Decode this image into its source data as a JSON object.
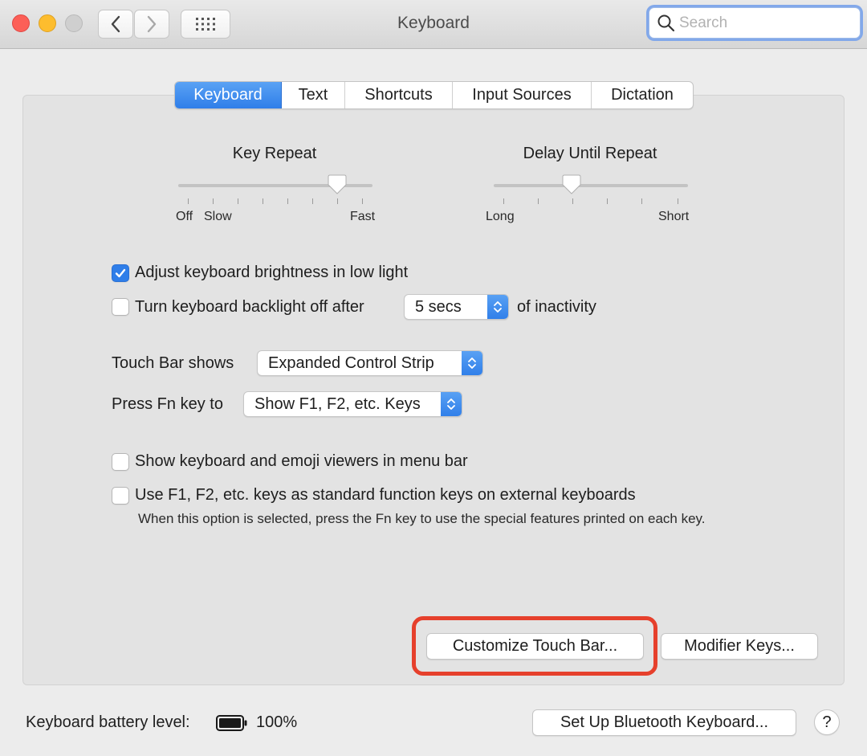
{
  "window": {
    "title": "Keyboard"
  },
  "search": {
    "placeholder": "Search"
  },
  "tabs": [
    {
      "label": "Keyboard",
      "active": true
    },
    {
      "label": "Text"
    },
    {
      "label": "Shortcuts"
    },
    {
      "label": "Input Sources"
    },
    {
      "label": "Dictation"
    }
  ],
  "key_repeat": {
    "title": "Key Repeat",
    "labels": {
      "off": "Off",
      "slow": "Slow",
      "fast": "Fast"
    },
    "value_fraction": 0.82
  },
  "delay_until_repeat": {
    "title": "Delay Until Repeat",
    "labels": {
      "long": "Long",
      "short": "Short"
    },
    "value_fraction": 0.4
  },
  "options": {
    "brightness": {
      "label": "Adjust keyboard brightness in low light",
      "checked": true
    },
    "backlight": {
      "label": "Turn keyboard backlight off after",
      "checked": false,
      "selected": "5 secs",
      "suffix": "of inactivity"
    }
  },
  "touch_bar": {
    "label": "Touch Bar shows",
    "selected": "Expanded Control Strip"
  },
  "fn_key": {
    "label": "Press Fn key to",
    "selected": "Show F1, F2, etc. Keys"
  },
  "viewers": {
    "label": "Show keyboard and emoji viewers in menu bar",
    "checked": false
  },
  "function_keys": {
    "label": "Use F1, F2, etc. keys as standard function keys on external keyboards",
    "note": "When this option is selected, press the Fn key to use the special features printed on each key.",
    "checked": false
  },
  "buttons": {
    "customize": "Customize Touch Bar...",
    "modifier": "Modifier Keys...",
    "bluetooth": "Set Up Bluetooth Keyboard...",
    "help": "?"
  },
  "battery": {
    "label": "Keyboard battery level:",
    "value": "100%",
    "level_fraction": 1.0
  },
  "colors": {
    "accent": "#2f7ee9",
    "highlight": "#e6402c"
  }
}
